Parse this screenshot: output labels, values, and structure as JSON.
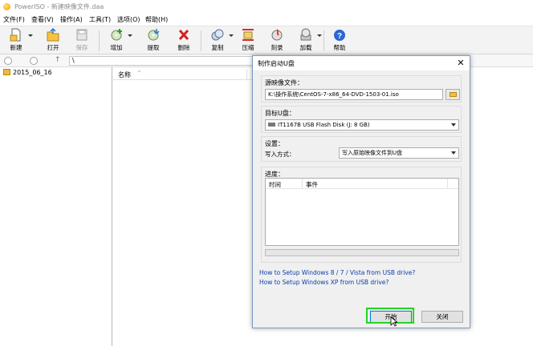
{
  "window": {
    "title": "PowerISO - 新建映像文件.daa"
  },
  "menu": [
    "文件(F)",
    "查看(V)",
    "操作(A)",
    "工具(T)",
    "选项(O)",
    "帮助(H)"
  ],
  "toolbar": {
    "new": "新建",
    "open": "打开",
    "save": "保存",
    "add": "增加",
    "extract": "提取",
    "delete": "删除",
    "copy": "复制",
    "compress": "压缩",
    "burn": "刻录",
    "mount": "加载",
    "help": "帮助"
  },
  "address": {
    "path": "\\"
  },
  "tree": {
    "root": "2015_06_16"
  },
  "list": {
    "name_header": "名称"
  },
  "dialog": {
    "title": "制作启动U盘",
    "source_label": "源映像文件：",
    "source_value": "K:\\操作系统\\CentOS-7-x86_64-DVD-1503-01.iso",
    "target_label": "目标U盘：",
    "target_value": "IT1167B USB Flash Disk (J: 8 GB)",
    "settings_label": "设置：",
    "write_mode_label": "写入方式：",
    "write_mode_value": "写入原始映像文件到U盘",
    "progress_label": "进度：",
    "log_col_time": "时间",
    "log_col_event": "事件",
    "progress_value": 0,
    "link1": "How to Setup Windows 8 / 7 / Vista from USB drive?",
    "link2": "How to Setup Windows XP from USB drive?",
    "start_button": "开始",
    "close_button": "关闭"
  },
  "colors": {
    "accent_link": "#0b3fa8",
    "highlight_box": "#22d622"
  }
}
